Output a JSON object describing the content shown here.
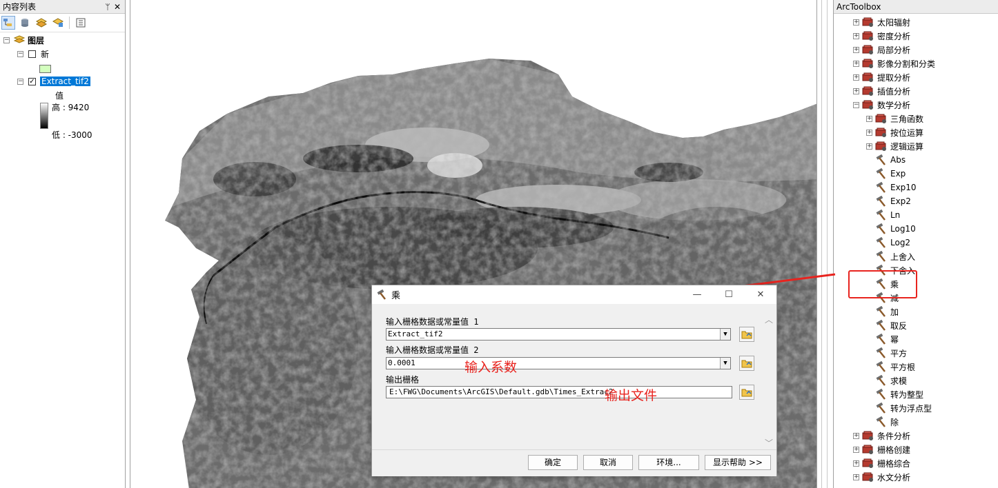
{
  "toc": {
    "title": "内容列表",
    "pin_glyph": "ᛘ",
    "close_glyph": "✕",
    "root_label": "图层",
    "layer1_label": "新",
    "layer2_label": "Extract_tif2",
    "legend_value_title": "值",
    "legend_high": "高 : 9420",
    "legend_low": "低 : -3000",
    "expand_glyph": "−",
    "check_glyph": "✓"
  },
  "annotations": {
    "coefficient": "输入系数",
    "output_file": "输出文件"
  },
  "dialog": {
    "title": "乘",
    "minimize": "—",
    "maximize": "☐",
    "close": "✕",
    "param1_label": "输入栅格数据或常量值 1",
    "param1_value": "Extract_tif2",
    "param2_label": "输入栅格数据或常量值 2",
    "param2_value": "0.0001",
    "output_label": "输出栅格",
    "output_value": "E:\\FWG\\Documents\\ArcGIS\\Default.gdb\\Times_Extrac2",
    "dropdown_glyph": "▼",
    "scroll_up": "︿",
    "scroll_down": "﹀",
    "buttons": {
      "ok": "确定",
      "cancel": "取消",
      "environments": "环境...",
      "show_help": "显示帮助 >>"
    }
  },
  "toolbox": {
    "title": "ArcToolbox",
    "plus": "+",
    "minus": "−",
    "toolsets_top": [
      "太阳辐射",
      "密度分析",
      "局部分析",
      "影像分割和分类",
      "提取分析",
      "插值分析"
    ],
    "math": "数学分析",
    "math_subsets": [
      "三角函数",
      "按位运算",
      "逻辑运算"
    ],
    "math_tools": [
      "Abs",
      "Exp",
      "Exp10",
      "Exp2",
      "Ln",
      "Log10",
      "Log2",
      "上舍入",
      "下舍入",
      "乘",
      "减",
      "加",
      "取反",
      "幂",
      "平方",
      "平方根",
      "求模",
      "转为整型",
      "转为浮点型",
      "除"
    ],
    "toolsets_bottom": [
      "条件分析",
      "栅格创建",
      "栅格综合",
      "水文分析"
    ],
    "selected_tool": "乘"
  },
  "colors": {
    "annotation": "#e8231e",
    "selection": "#0078d7"
  }
}
